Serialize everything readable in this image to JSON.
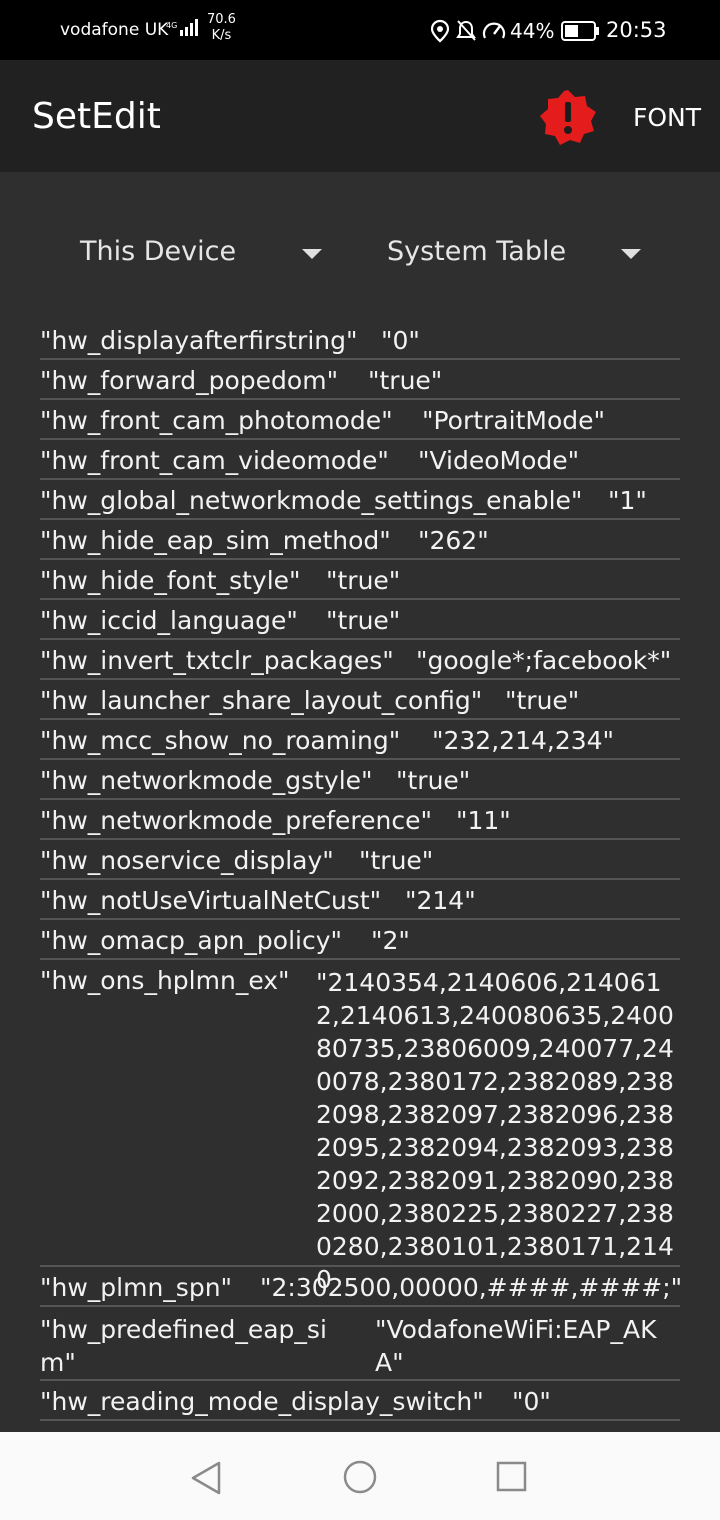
{
  "status_bar": {
    "carrier": "vodafone UK",
    "network_type": "4G",
    "speed_value": "70.6",
    "speed_unit": "K/s",
    "battery": "44%",
    "time": "20:53"
  },
  "app_bar": {
    "title": "SetEdit",
    "font_button": "FONT"
  },
  "selectors": {
    "device": "This Device",
    "table": "System Table"
  },
  "settings": [
    {
      "key": "\"hw_displayafterfirstring\"",
      "value": "\"0\""
    },
    {
      "key": "\"hw_forward_popedom\"",
      "value": "\"true\""
    },
    {
      "key": "\"hw_front_cam_photomode\"",
      "value": "\"PortraitMode\""
    },
    {
      "key": "\"hw_front_cam_videomode\"",
      "value": "\"VideoMode\""
    },
    {
      "key": "\"hw_global_networkmode_settings_enable\"",
      "value": "\"1\""
    },
    {
      "key": "\"hw_hide_eap_sim_method\"",
      "value": "\"262\""
    },
    {
      "key": "\"hw_hide_font_style\"",
      "value": "\"true\""
    },
    {
      "key": "\"hw_iccid_language\"",
      "value": "\"true\""
    },
    {
      "key": "\"hw_invert_txtclr_packages\"",
      "value": "\"google*;facebook*\""
    },
    {
      "key": "\"hw_launcher_share_layout_config\"",
      "value": "\"true\""
    },
    {
      "key": "\"hw_mcc_show_no_roaming\"",
      "value": "\"232,214,234\""
    },
    {
      "key": "\"hw_networkmode_gstyle\"",
      "value": "\"true\""
    },
    {
      "key": "\"hw_networkmode_preference\"",
      "value": "\"11\""
    },
    {
      "key": "\"hw_noservice_display\"",
      "value": "\"true\""
    },
    {
      "key": "\"hw_notUseVirtualNetCust\"",
      "value": "\"214\""
    },
    {
      "key": "\"hw_omacp_apn_policy\"",
      "value": "\"2\""
    },
    {
      "key": "\"hw_ons_hplmn_ex\"",
      "value": "\"2140354,2140606,2140612,2140613,240080635,240080735,23806009,240077,240078,2380172,2382089,2382098,2382097,2382096,2382095,2382094,2382093,2382092,2382091,2382090,2382000,2380225,2380227,2380280,2380101,2380171,2140"
    },
    {
      "key": "\"hw_plmn_spn\"",
      "value": "\"2:302500,00000,####,####;\""
    },
    {
      "key": "\"hw_predefined_eap_sim\"",
      "value": "\"VodafoneWiFi:EAP_AKA\""
    },
    {
      "key": "\"hw_reading_mode_display_switch\"",
      "value": "\"0\""
    }
  ]
}
